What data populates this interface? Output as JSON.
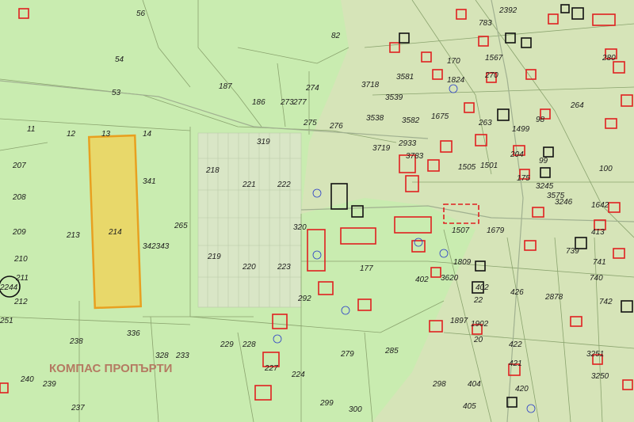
{
  "watermark": "КОМПАС ПРОПЪРТИ",
  "highlighted_parcel": "214",
  "colors": {
    "background": "#c9ecb0",
    "settlement": "#d6e4b8",
    "highlight_fill": "#e8d86a",
    "highlight_stroke": "#e8a020",
    "building_red": "#e02020",
    "building_black": "#111111",
    "blue_text": "#2a3ec8"
  },
  "parcels": [
    {
      "id": "56"
    },
    {
      "id": "54"
    },
    {
      "id": "53"
    },
    {
      "id": "82"
    },
    {
      "id": "187"
    },
    {
      "id": "186"
    },
    {
      "id": "274"
    },
    {
      "id": "273"
    },
    {
      "id": "277"
    },
    {
      "id": "275"
    },
    {
      "id": "276"
    },
    {
      "id": "3718"
    },
    {
      "id": "3581"
    },
    {
      "id": "3539"
    },
    {
      "id": "3538"
    },
    {
      "id": "3582"
    },
    {
      "id": "1675"
    },
    {
      "id": "11"
    },
    {
      "id": "12"
    },
    {
      "id": "13"
    },
    {
      "id": "14"
    },
    {
      "id": "319"
    },
    {
      "id": "3719"
    },
    {
      "id": "2933"
    },
    {
      "id": "207"
    },
    {
      "id": "218"
    },
    {
      "id": "221"
    },
    {
      "id": "222"
    },
    {
      "id": "341"
    },
    {
      "id": "208"
    },
    {
      "id": "265"
    },
    {
      "id": "209"
    },
    {
      "id": "213"
    },
    {
      "id": "320"
    },
    {
      "id": "210"
    },
    {
      "id": "219"
    },
    {
      "id": "220"
    },
    {
      "id": "223"
    },
    {
      "id": "342343"
    },
    {
      "id": "211"
    },
    {
      "id": "2244"
    },
    {
      "id": "212"
    },
    {
      "id": "292"
    },
    {
      "id": "251"
    },
    {
      "id": "238"
    },
    {
      "id": "336"
    },
    {
      "id": "328"
    },
    {
      "id": "233"
    },
    {
      "id": "229"
    },
    {
      "id": "228"
    },
    {
      "id": "227"
    },
    {
      "id": "279"
    },
    {
      "id": "285"
    },
    {
      "id": "240"
    },
    {
      "id": "239"
    },
    {
      "id": "224"
    },
    {
      "id": "298"
    },
    {
      "id": "237"
    },
    {
      "id": "299"
    },
    {
      "id": "300"
    },
    {
      "id": "402"
    },
    {
      "id": "1897"
    },
    {
      "id": "20"
    },
    {
      "id": "404"
    },
    {
      "id": "405"
    },
    {
      "id": "420"
    },
    {
      "id": "422"
    },
    {
      "id": "421"
    },
    {
      "id": "3251"
    },
    {
      "id": "3250"
    },
    {
      "id": "2392"
    },
    {
      "id": "783"
    },
    {
      "id": "170"
    },
    {
      "id": "1824"
    },
    {
      "id": "280"
    },
    {
      "id": "1567"
    },
    {
      "id": "270"
    },
    {
      "id": "263"
    },
    {
      "id": "1499"
    },
    {
      "id": "98"
    },
    {
      "id": "204"
    },
    {
      "id": "99"
    },
    {
      "id": "100"
    },
    {
      "id": "175"
    },
    {
      "id": "3245"
    },
    {
      "id": "3575"
    },
    {
      "id": "3246"
    },
    {
      "id": "1642"
    },
    {
      "id": "413"
    },
    {
      "id": "741"
    },
    {
      "id": "740"
    },
    {
      "id": "742"
    },
    {
      "id": "426"
    },
    {
      "id": "402b",
      "label": "402"
    },
    {
      "id": "22"
    },
    {
      "id": "1902"
    },
    {
      "id": "1809"
    },
    {
      "id": "3620"
    },
    {
      "id": "177"
    },
    {
      "id": "1507"
    },
    {
      "id": "1679"
    },
    {
      "id": "2878"
    },
    {
      "id": "739"
    },
    {
      "id": "1505"
    },
    {
      "id": "3783"
    },
    {
      "id": "264"
    },
    {
      "id": "1501"
    }
  ]
}
